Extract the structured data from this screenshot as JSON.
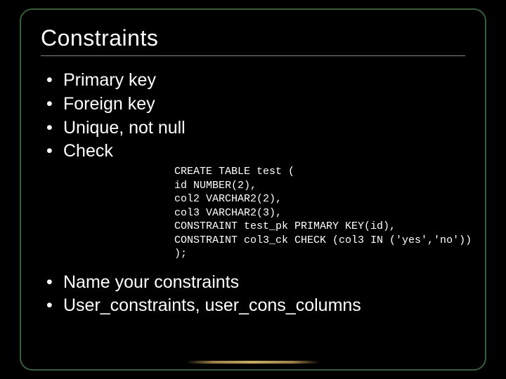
{
  "title": "Constraints",
  "bullets_top": [
    "Primary key",
    "Foreign key",
    "Unique, not null",
    "Check"
  ],
  "code": {
    "l0": "CREATE TABLE test (",
    "l1": "id NUMBER(2),",
    "l2": "col2 VARCHAR2(2),",
    "l3": "col3 VARCHAR2(3),",
    "l4": "CONSTRAINT test_pk PRIMARY KEY(id),",
    "l5": "CONSTRAINT col3_ck CHECK (col3 IN ('yes','no'))",
    "l6": ");"
  },
  "bullets_bottom": [
    "Name your constraints",
    "User_constraints, user_cons_columns"
  ]
}
